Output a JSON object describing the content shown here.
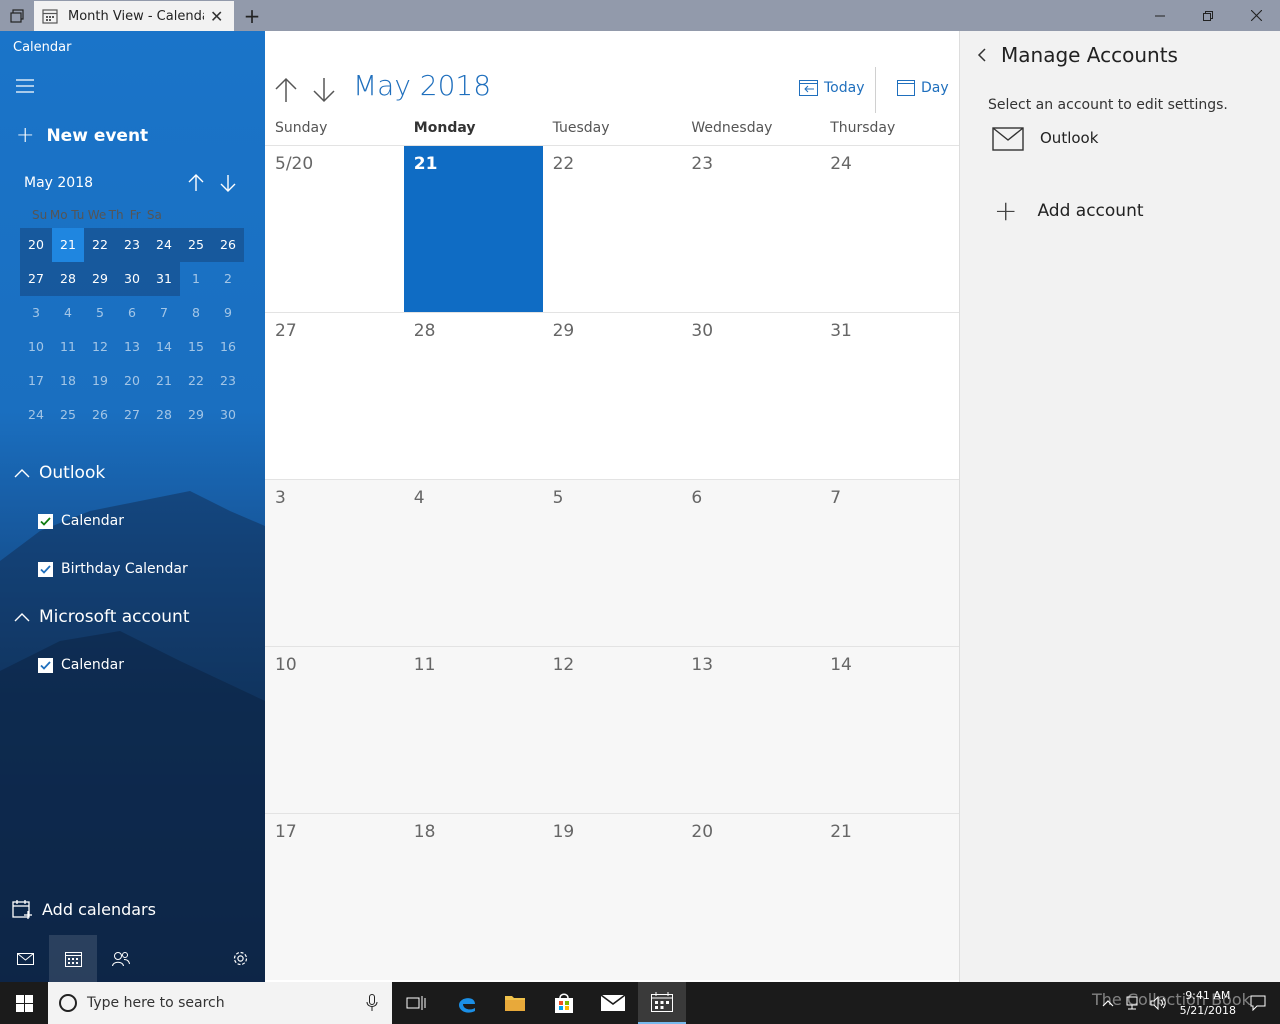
{
  "titlebar": {
    "tab_title": "Month View - Calendar"
  },
  "sidebar": {
    "app_name": "Calendar",
    "new_event": "New event",
    "mini_month": "May 2018",
    "dow": [
      "Su",
      "Mo",
      "Tu",
      "We",
      "Th",
      "Fr",
      "Sa"
    ],
    "weeks": [
      [
        "20",
        "21",
        "22",
        "23",
        "24",
        "25",
        "26"
      ],
      [
        "27",
        "28",
        "29",
        "30",
        "31",
        "1",
        "2"
      ],
      [
        "3",
        "4",
        "5",
        "6",
        "7",
        "8",
        "9"
      ],
      [
        "10",
        "11",
        "12",
        "13",
        "14",
        "15",
        "16"
      ],
      [
        "17",
        "18",
        "19",
        "20",
        "21",
        "22",
        "23"
      ],
      [
        "24",
        "25",
        "26",
        "27",
        "28",
        "29",
        "30"
      ]
    ],
    "groups": [
      {
        "name": "Outlook",
        "items": [
          "Calendar",
          "Birthday Calendar"
        ]
      },
      {
        "name": "Microsoft account",
        "items": [
          "Calendar"
        ]
      }
    ],
    "add_calendars": "Add calendars"
  },
  "main": {
    "month_title": "May 2018",
    "today_label": "Today",
    "day_label": "Day",
    "dow": [
      "Sunday",
      "Monday",
      "Tuesday",
      "Wednesday",
      "Thursday"
    ],
    "weeks": [
      [
        "5/20",
        "21",
        "22",
        "23",
        "24"
      ],
      [
        "27",
        "28",
        "29",
        "30",
        "31"
      ],
      [
        "3",
        "4",
        "5",
        "6",
        "7"
      ],
      [
        "10",
        "11",
        "12",
        "13",
        "14"
      ],
      [
        "17",
        "18",
        "19",
        "20",
        "21"
      ]
    ]
  },
  "panel": {
    "title": "Manage Accounts",
    "subtitle": "Select an account to edit settings.",
    "account": "Outlook",
    "add_account": "Add account"
  },
  "taskbar": {
    "search_placeholder": "Type here to search",
    "time": "9:41 AM",
    "date": "5/21/2018"
  },
  "watermark": "The Collection Book",
  "colors": {
    "accent": "#1f6fbd",
    "today_fill": "#0f6cc4",
    "sidebar": "#1a74c9"
  }
}
